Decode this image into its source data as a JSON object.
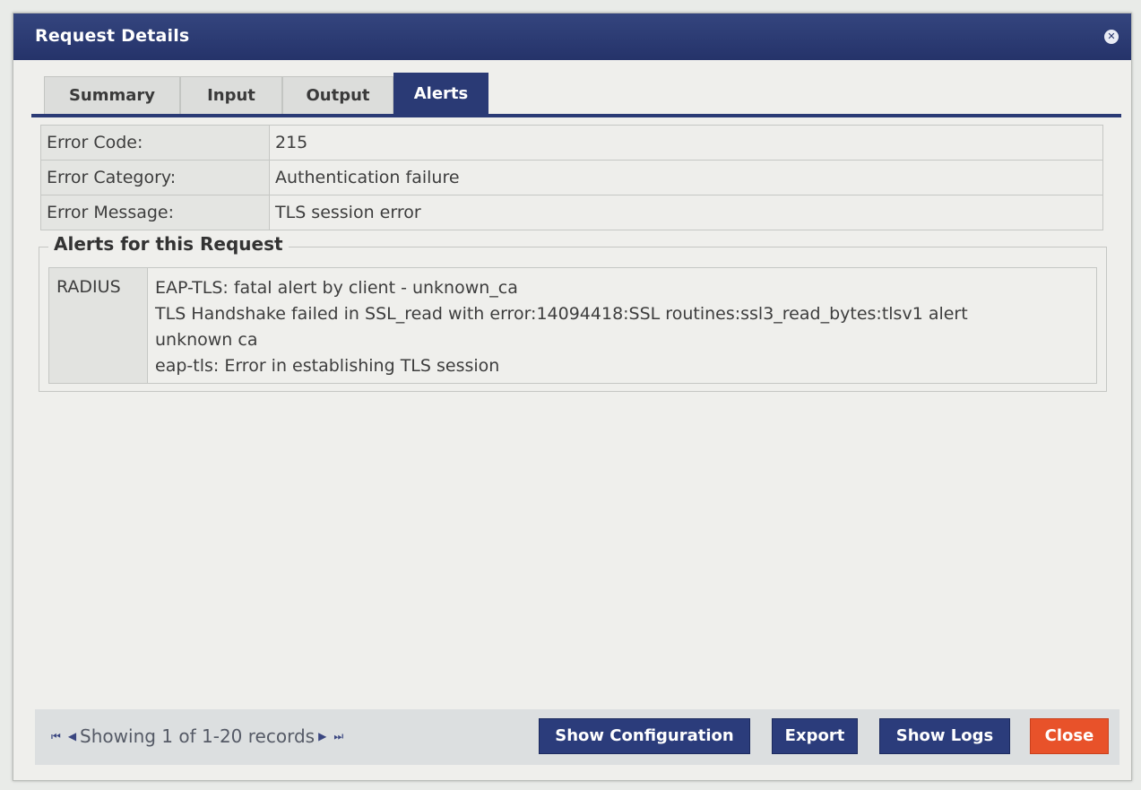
{
  "dialog": {
    "title": "Request Details",
    "close_glyph": "✕"
  },
  "tabs": [
    "Summary",
    "Input",
    "Output",
    "Alerts"
  ],
  "details": [
    {
      "label": "Error Code:",
      "value": "215"
    },
    {
      "label": "Error Category:",
      "value": "Authentication failure"
    },
    {
      "label": "Error Message:",
      "value": "TLS session error"
    }
  ],
  "alerts": {
    "legend": "Alerts for this Request",
    "source": "RADIUS",
    "lines": [
      "EAP-TLS: fatal alert by client - unknown_ca",
      "TLS Handshake failed in SSL_read with error:14094418:SSL routines:ssl3_read_bytes:tlsv1 alert",
      "unknown ca",
      "eap-tls: Error in establishing TLS session"
    ]
  },
  "footer": {
    "pager_text": "Showing 1 of 1-20 records",
    "buttons": {
      "show_configuration": "Show Configuration",
      "export": "Export",
      "show_logs": "Show Logs",
      "close": "Close"
    }
  }
}
